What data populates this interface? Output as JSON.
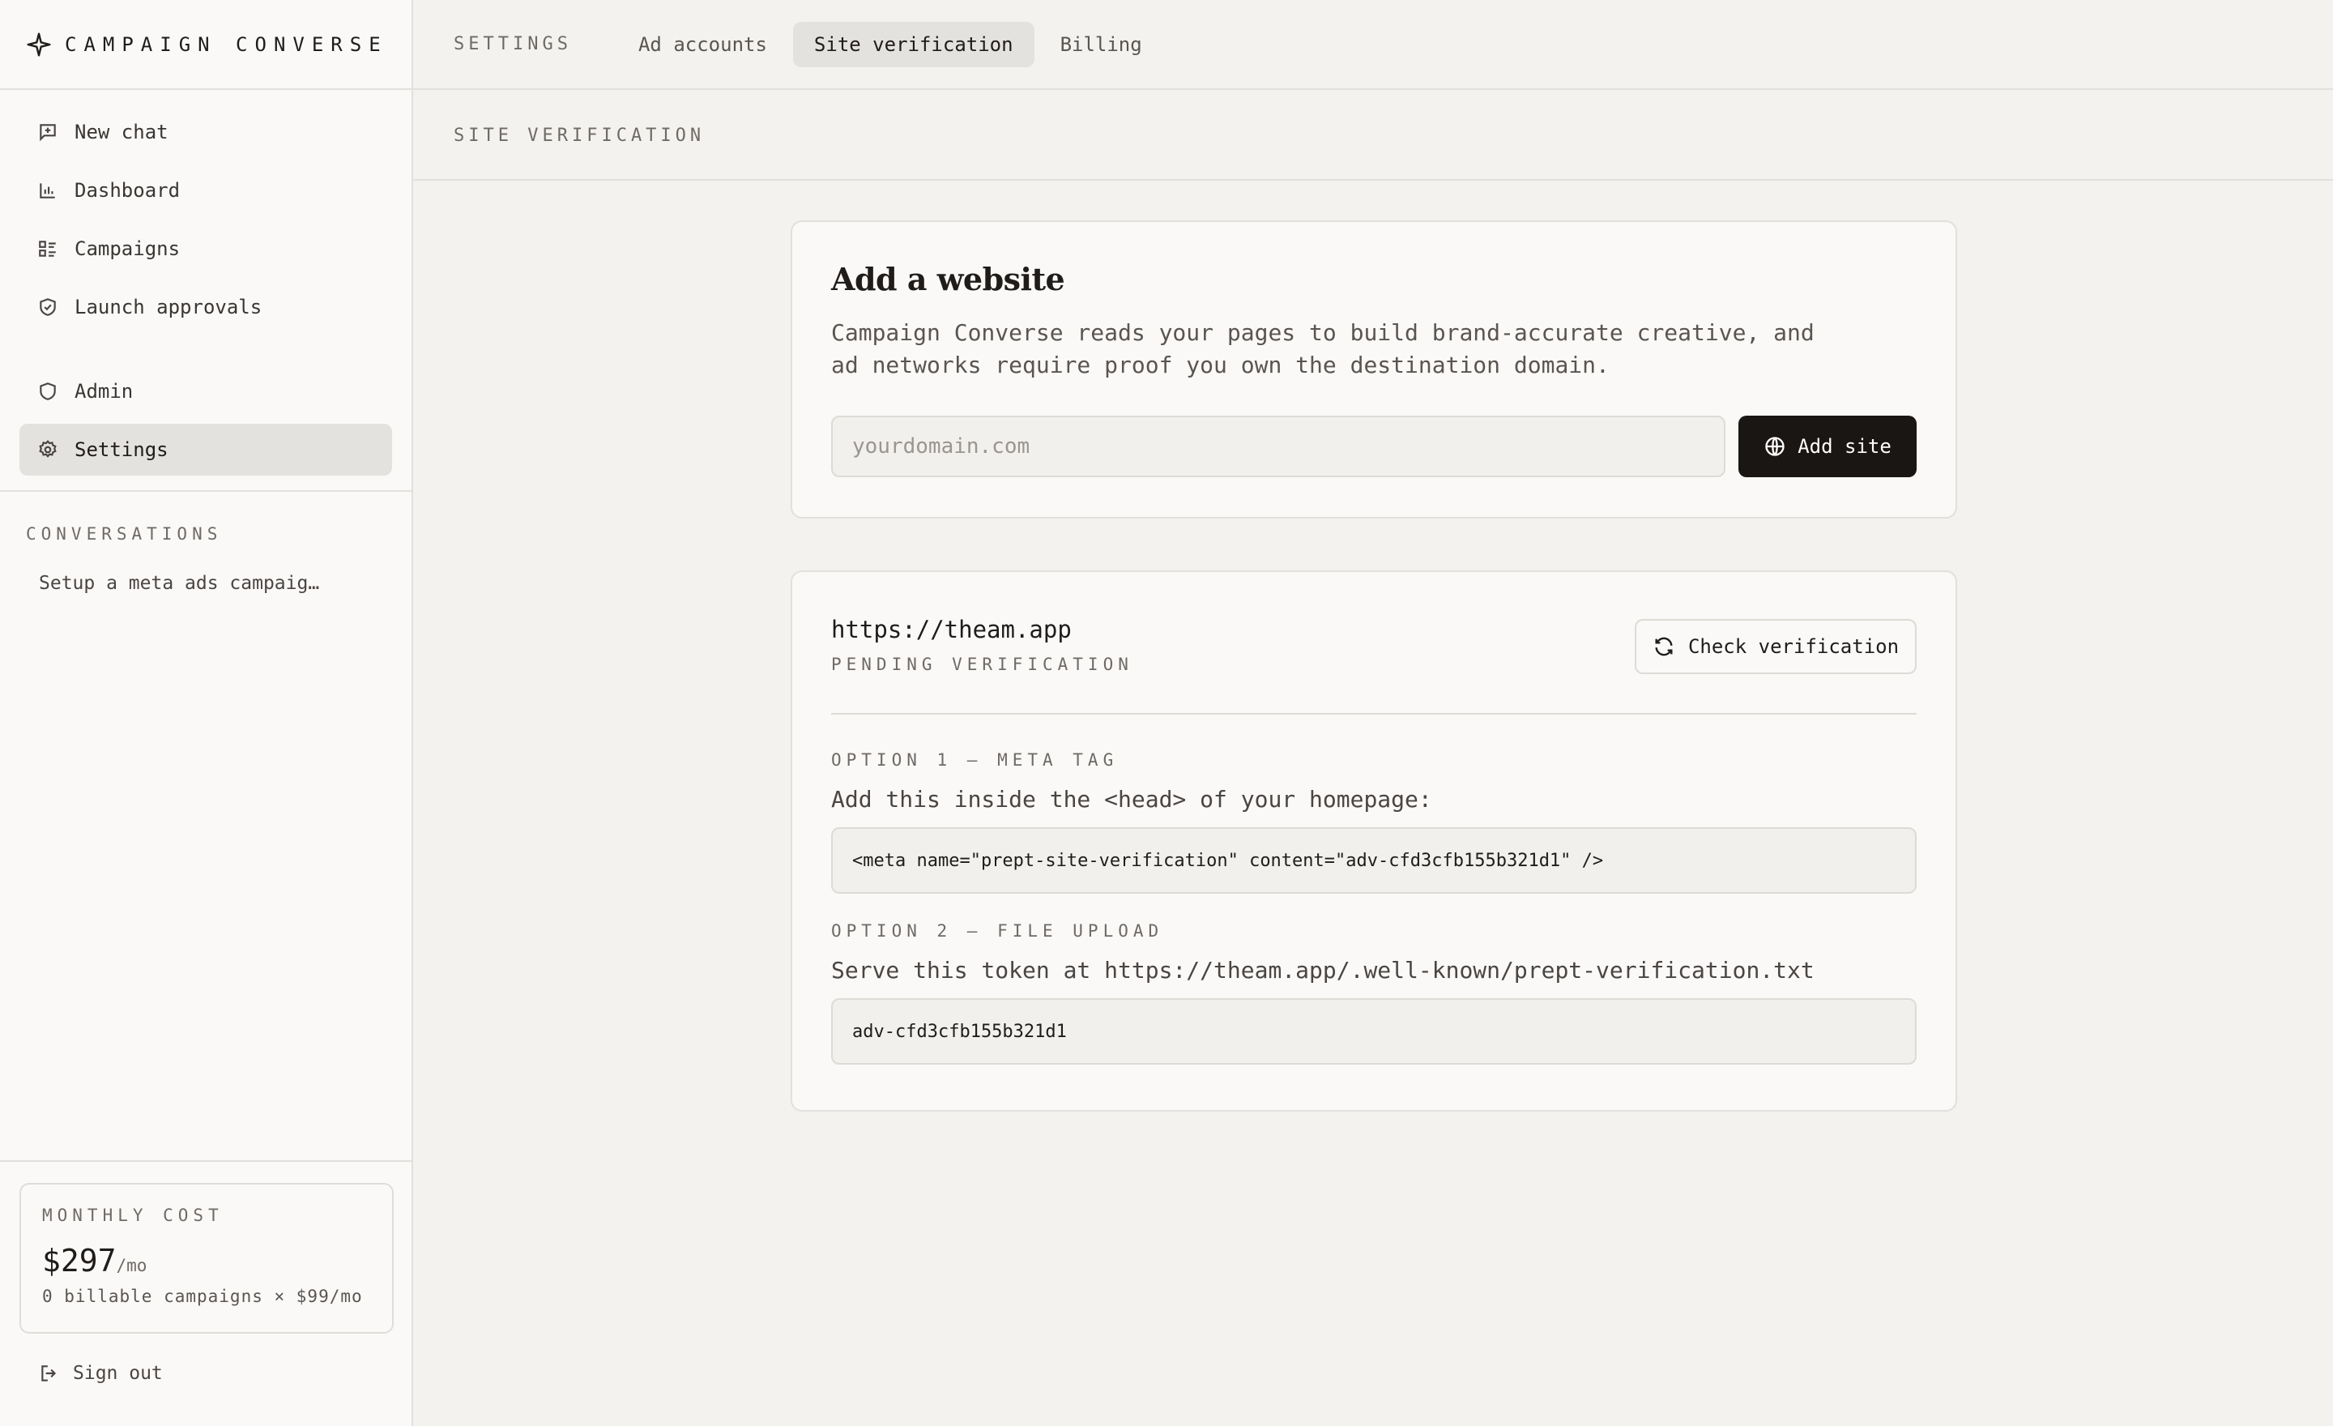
{
  "brand": {
    "name": "CAMPAIGN CONVERSE",
    "icon": "sparkle-icon"
  },
  "sidebar": {
    "items": [
      {
        "label": "New chat",
        "icon": "message-plus-icon"
      },
      {
        "label": "Dashboard",
        "icon": "bar-chart-icon"
      },
      {
        "label": "Campaigns",
        "icon": "list-icon"
      },
      {
        "label": "Launch approvals",
        "icon": "shield-check-icon"
      }
    ],
    "admin_items": [
      {
        "label": "Admin",
        "icon": "shield-icon"
      },
      {
        "label": "Settings",
        "icon": "gear-icon",
        "active": true
      }
    ],
    "conversations_label": "CONVERSATIONS",
    "conversations": [
      "Setup a meta ads campaig…"
    ],
    "cost": {
      "label": "MONTHLY COST",
      "price": "$297",
      "per": "/mo",
      "detail": "0 billable campaigns × $99/mo"
    },
    "signout": "Sign out"
  },
  "header": {
    "crumb": "SETTINGS",
    "tabs": [
      {
        "label": "Ad accounts"
      },
      {
        "label": "Site verification",
        "active": true
      },
      {
        "label": "Billing"
      }
    ]
  },
  "subheader": {
    "title": "SITE VERIFICATION"
  },
  "add_site": {
    "title": "Add a website",
    "description": "Campaign Converse reads your pages to build brand-accurate creative, and ad networks require proof you own the destination domain.",
    "placeholder": "yourdomain.com",
    "value": "",
    "button": "Add site"
  },
  "site": {
    "url": "https://theam.app",
    "status": "PENDING VERIFICATION",
    "check_button": "Check verification",
    "option1": {
      "label": "OPTION 1 — META TAG",
      "description": "Add this inside the <head> of your homepage:",
      "code": "<meta name=\"prept-site-verification\" content=\"adv-cfd3cfb155b321d1\" />"
    },
    "option2": {
      "label": "OPTION 2 — FILE UPLOAD",
      "description": "Serve this token at https://theam.app/.well-known/prept-verification.txt",
      "code": "adv-cfd3cfb155b321d1"
    }
  },
  "colors": {
    "accent": "#1a1614",
    "background": "#f3f2ef",
    "card": "#faf9f7",
    "active_bg": "#e4e2de"
  }
}
